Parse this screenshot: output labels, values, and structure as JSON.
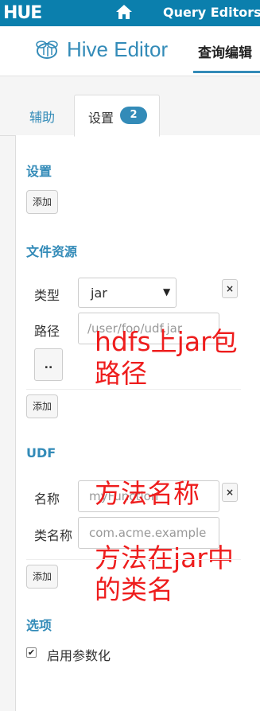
{
  "topnav": {
    "logo": "HUE",
    "home_icon": "home-icon",
    "query_editors": "Query Editors"
  },
  "header": {
    "title": "Hive Editor",
    "active_tab": "查询编辑"
  },
  "tabs": {
    "assist": "辅助",
    "settings": "设置",
    "settings_count": "2"
  },
  "settings_section": {
    "title": "设置",
    "add": "添加"
  },
  "file_resources": {
    "title": "文件资源",
    "type_label": "类型",
    "type_value": "jar",
    "path_label": "路径",
    "path_placeholder": "/user/foo/udf.jar",
    "browse": "..",
    "remove": "×",
    "add": "添加",
    "annotation": "hdfs上jar包\n路径"
  },
  "udf": {
    "title": "UDF",
    "name_label": "名称",
    "name_placeholder": "myFunction",
    "class_label": "类名称",
    "class_placeholder": "com.acme.example",
    "remove": "×",
    "add": "添加",
    "name_annotation": "方法名称",
    "class_annotation": "方法在jar中\n的类名"
  },
  "options": {
    "title": "选项",
    "parameterization_label": "启用参数化",
    "parameterization_checked": true
  },
  "colors": {
    "brand": "#0b7fad",
    "accent": "#338bb8",
    "annotation": "#ee1d1d"
  }
}
